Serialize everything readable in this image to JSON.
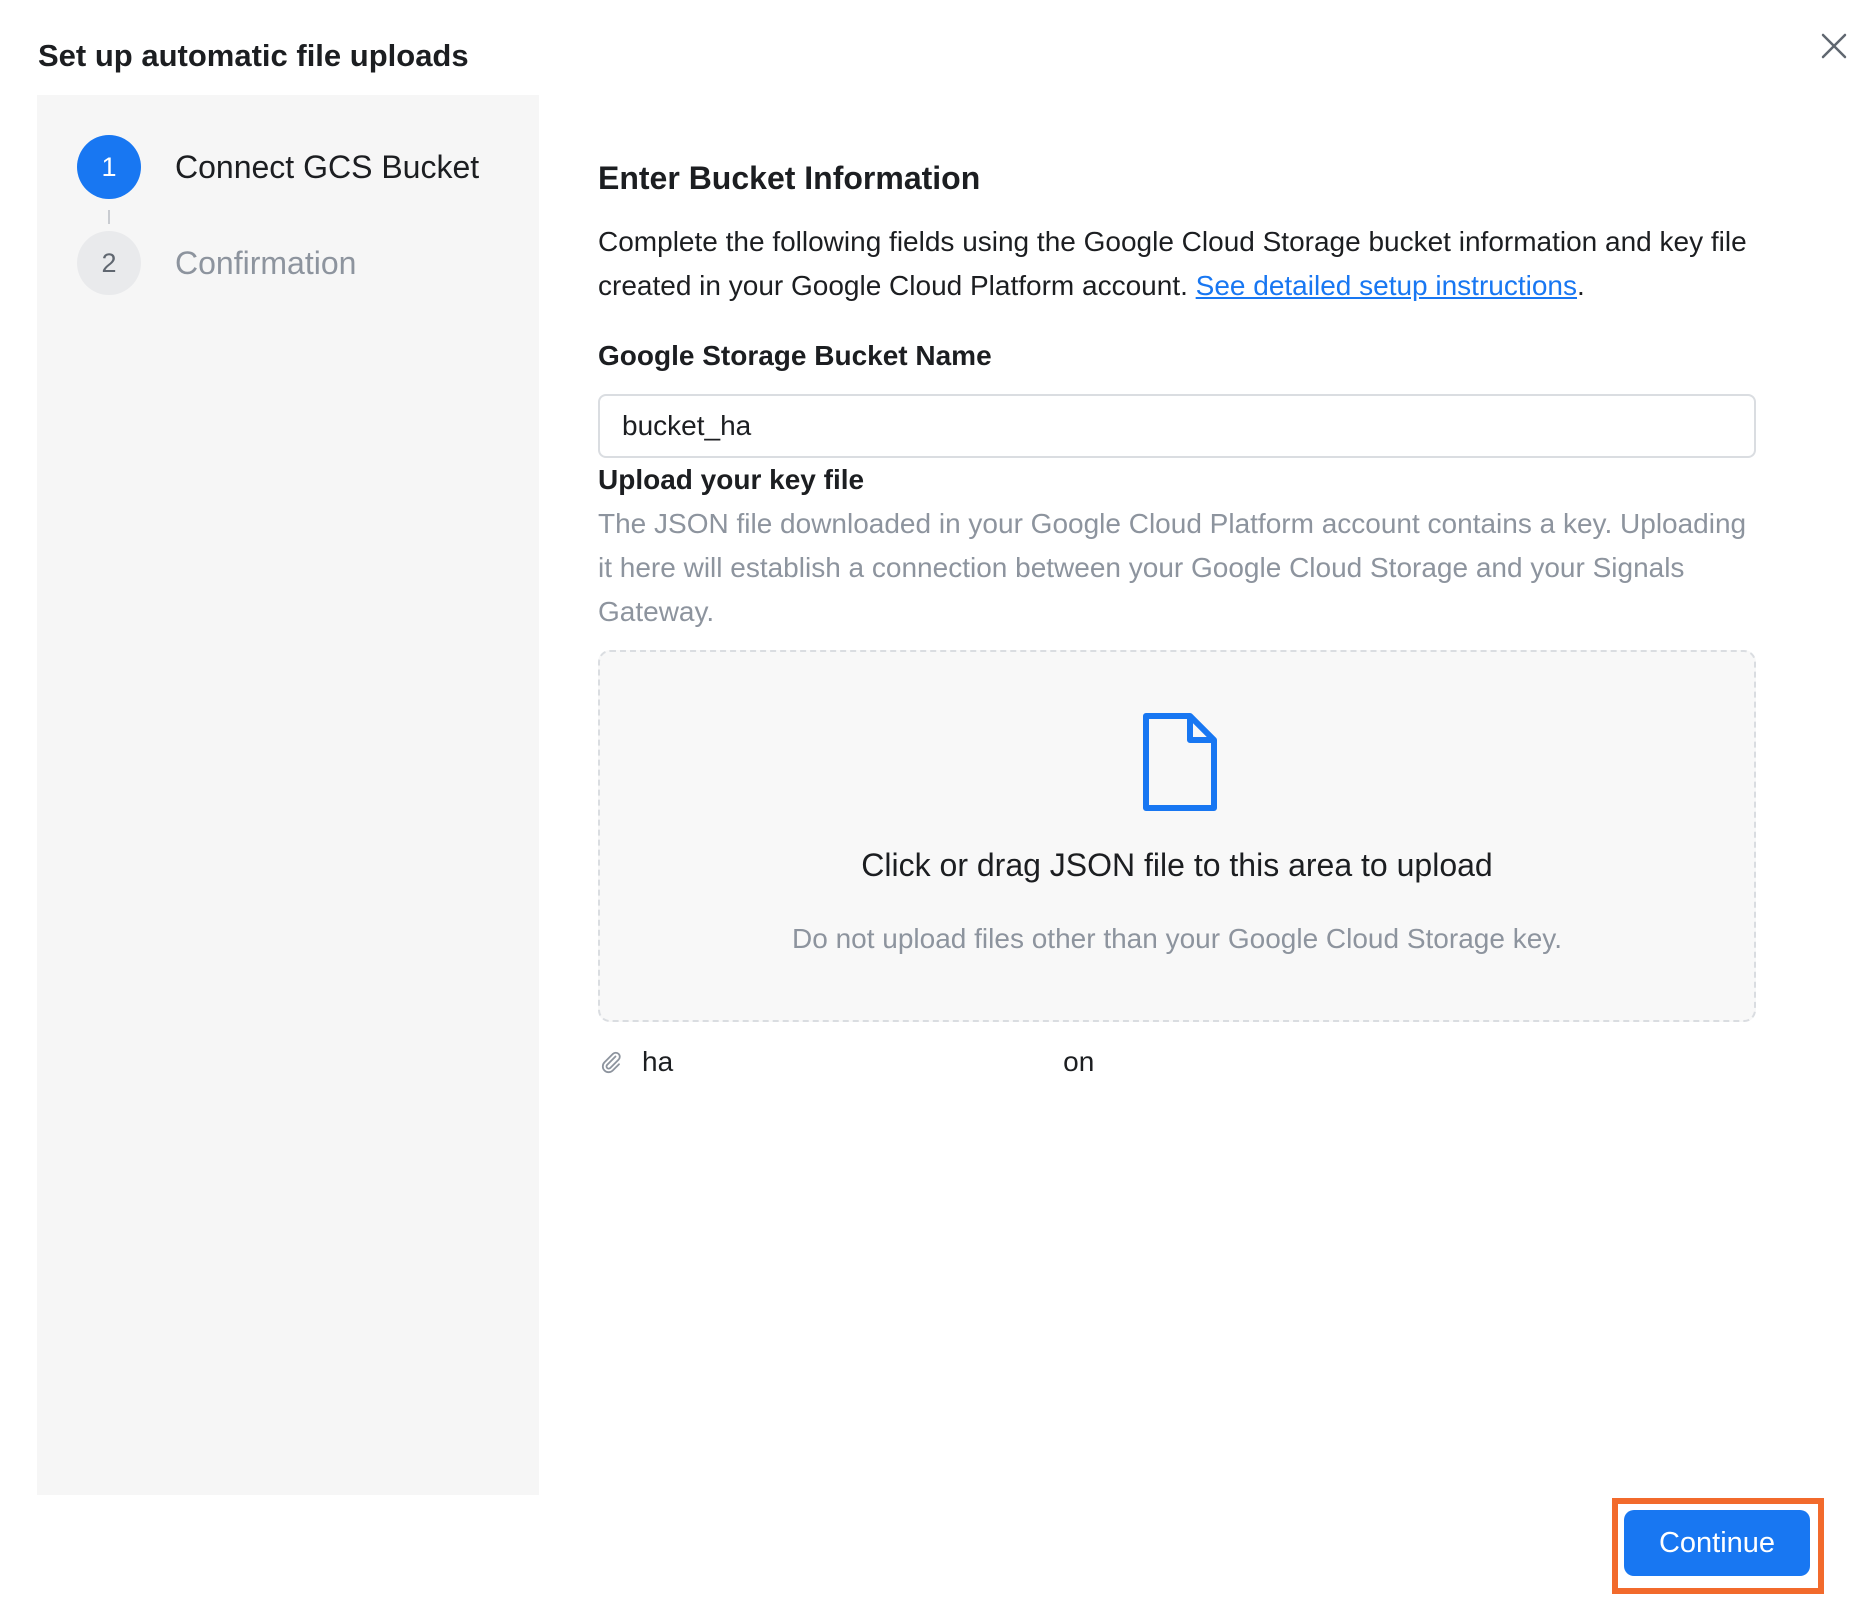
{
  "dialog": {
    "title": "Set up automatic file uploads",
    "close_icon": "close-icon"
  },
  "stepper": {
    "steps": [
      {
        "number": "1",
        "label": "Connect GCS Bucket",
        "state": "active"
      },
      {
        "number": "2",
        "label": "Confirmation",
        "state": "pending"
      }
    ]
  },
  "main": {
    "heading": "Enter Bucket Information",
    "description": "Complete the following fields using the Google Cloud Storage bucket information and key file created in your Google Cloud Platform account. ",
    "description_link": "See detailed setup instructions",
    "description_end": ".",
    "bucket_field": {
      "label": "Google Storage Bucket Name",
      "value": "bucket_ha"
    },
    "key_file": {
      "label": "Upload your key file",
      "description": "The JSON file downloaded in your Google Cloud Platform account contains a key. Uploading it here will establish a connection between your Google Cloud Storage and your Signals Gateway.",
      "dropzone_title": "Click or drag JSON file to this area to upload",
      "dropzone_hint": "Do not upload files other than your Google Cloud Storage key.",
      "dropzone_icon": "file-icon",
      "uploaded_icon": "paperclip-icon",
      "uploaded_name_start": "ha",
      "uploaded_name_end": "on"
    }
  },
  "footer": {
    "continue_label": "Continue"
  },
  "colors": {
    "primary": "#1877f2",
    "highlight": "#f26a2c",
    "sidebar_bg": "#f6f6f6",
    "muted_text": "#8d949e"
  }
}
